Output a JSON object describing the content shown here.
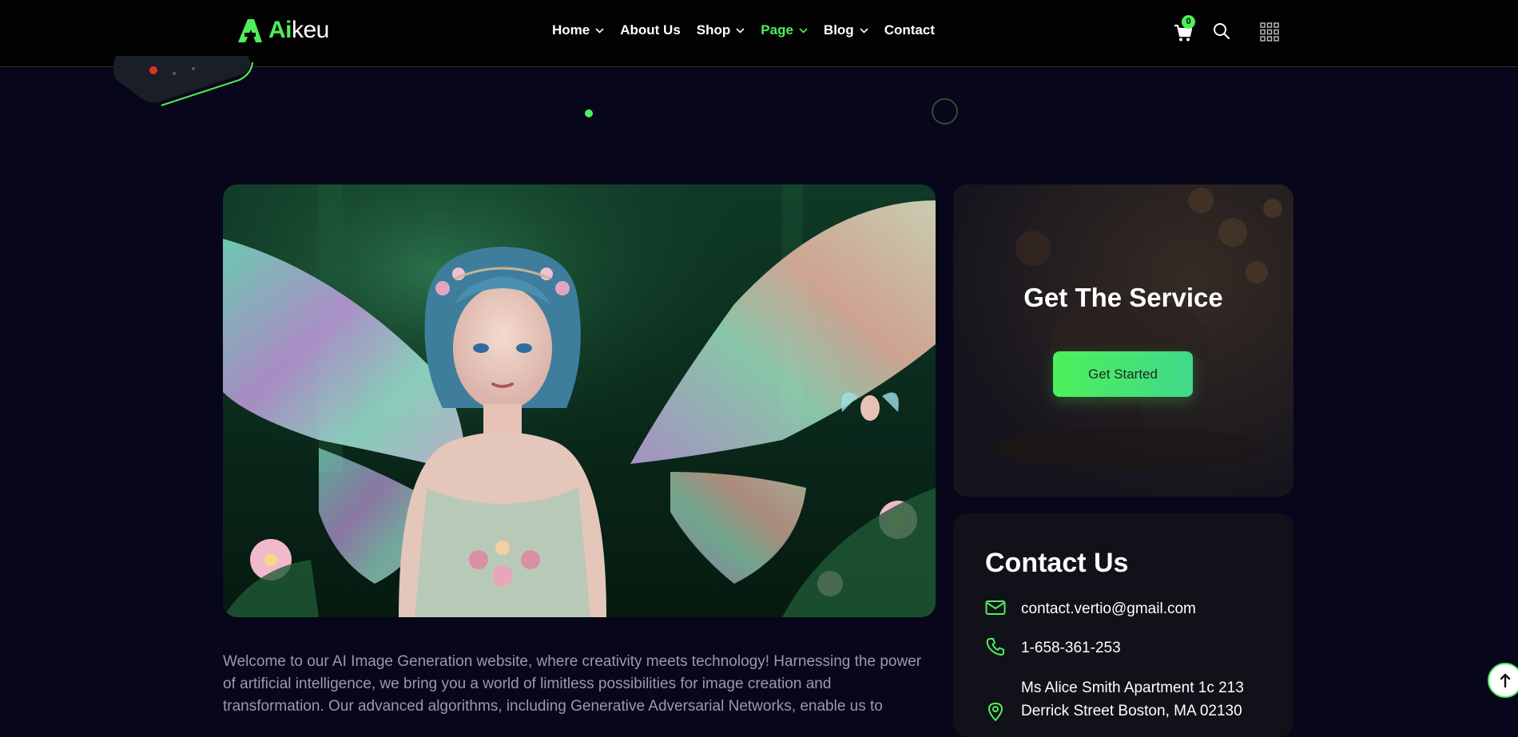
{
  "brand": {
    "accent": "Ai",
    "rest": "keu",
    "accent_color": "#4ef05a"
  },
  "nav": {
    "items": [
      {
        "label": "Home",
        "dropdown": true,
        "active": false
      },
      {
        "label": "About Us",
        "dropdown": false,
        "active": false
      },
      {
        "label": "Shop",
        "dropdown": true,
        "active": false
      },
      {
        "label": "Page",
        "dropdown": true,
        "active": true
      },
      {
        "label": "Blog",
        "dropdown": true,
        "active": false
      },
      {
        "label": "Contact",
        "dropdown": false,
        "active": false
      }
    ]
  },
  "header_icons": {
    "cart_count": "0",
    "cart_icon": "cart-icon",
    "search_icon": "search-icon",
    "menu_icon": "grid-menu-icon"
  },
  "intro": {
    "text": "Welcome to our AI Image Generation website, where creativity meets technology! Harnessing the power of artificial intelligence, we bring you a world of limitless possibilities for image creation and transformation. Our advanced algorithms, including Generative Adversarial Networks, enable us to"
  },
  "service": {
    "title": "Get The Service",
    "button_label": "Get Started"
  },
  "contact": {
    "title": "Contact Us",
    "email": "contact.vertio@gmail.com",
    "phone": "1-658-361-253",
    "address_line1": "Ms Alice Smith Apartment 1c 213",
    "address_line2": "Derrick Street Boston, MA 02130"
  },
  "colors": {
    "background": "#07061a",
    "header": "#020203",
    "accent": "#4ef05a",
    "card": "#111119",
    "muted_text": "#9a9aa8"
  }
}
